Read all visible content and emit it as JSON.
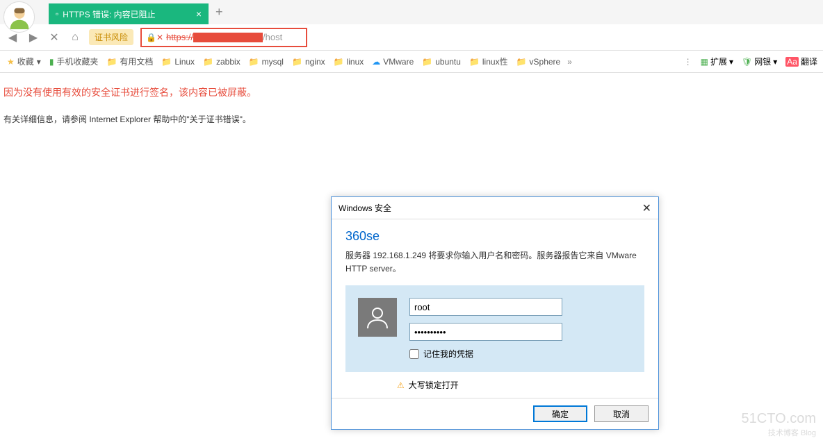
{
  "tab": {
    "title": "HTTPS 错误: 内容已阻止"
  },
  "toolbar": {
    "cert_warning": "证书风险"
  },
  "url": {
    "scheme": "https://",
    "path": "/host"
  },
  "bookmarks": {
    "fav": "收藏",
    "mobile": "手机收藏夹",
    "items": [
      "有用文档",
      "Linux",
      "zabbix",
      "mysql",
      "nginx",
      "linux",
      "VMware",
      "ubuntu",
      "linux性",
      "vSphere"
    ]
  },
  "right_tools": {
    "extend": "扩展",
    "bank": "网银",
    "translate": "翻译"
  },
  "page": {
    "error_title": "因为没有使用有效的安全证书进行签名，该内容已被屏蔽。",
    "error_text": "有关详细信息，请参阅 Internet Explorer 帮助中的\"关于证书错误\"。"
  },
  "dialog": {
    "title": "Windows 安全",
    "app": "360se",
    "message": "服务器 192.168.1.249 将要求你输入用户名和密码。服务器报告它来自 VMware HTTP server。",
    "username": "root",
    "password": "●●●●●●●●●●",
    "remember": "记住我的凭据",
    "caps_warning": "大写锁定打开",
    "ok": "确定",
    "cancel": "取消"
  },
  "watermark": {
    "main": "51CTO.com",
    "sub": "技术博客  Blog"
  }
}
